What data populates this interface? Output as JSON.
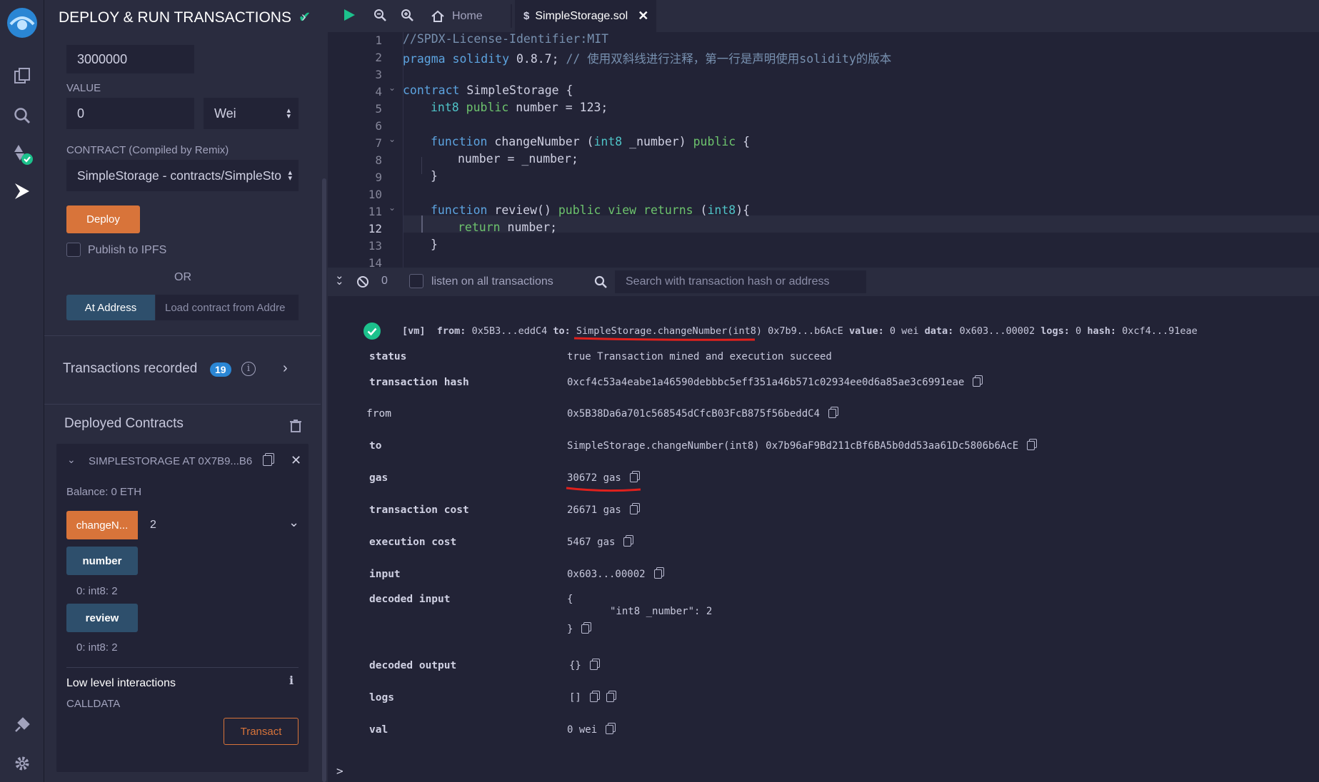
{
  "panel": {
    "title": "DEPLOY & RUN TRANSACTIONS",
    "gas_limit": "3000000",
    "value_label": "VALUE",
    "value": "0",
    "value_unit": "Wei",
    "contract_label": "CONTRACT",
    "contract_note": "(Compiled by Remix)",
    "contract_selected": "SimpleStorage - contracts/SimpleSto",
    "deploy_label": "Deploy",
    "publish_label": "Publish to IPFS",
    "or_label": "OR",
    "at_address_label": "At Address",
    "load_placeholder": "Load contract from Addre",
    "tx_recorded_label": "Transactions recorded",
    "tx_recorded_count": "19",
    "deployed_label": "Deployed Contracts",
    "instance_name": "SIMPLESTORAGE AT 0X7B9...B6",
    "balance": "Balance: 0 ETH",
    "change_btn": "changeN...",
    "change_input": "2",
    "number_btn": "number",
    "number_result": "0: int8: 2",
    "review_btn": "review",
    "review_result": "0: int8: 2",
    "low_level_label": "Low level interactions",
    "calldata_label": "CALLDATA",
    "transact_label": "Transact"
  },
  "tabs": {
    "home": "Home",
    "file": "SimpleStorage.sol"
  },
  "code_lines": [
    {
      "n": "1"
    },
    {
      "n": "2"
    },
    {
      "n": "3"
    },
    {
      "n": "4"
    },
    {
      "n": "5"
    },
    {
      "n": "6"
    },
    {
      "n": "7"
    },
    {
      "n": "8"
    },
    {
      "n": "9"
    },
    {
      "n": "10"
    },
    {
      "n": "11"
    },
    {
      "n": "12"
    },
    {
      "n": "13"
    },
    {
      "n": "14"
    }
  ],
  "code": {
    "l1": "//SPDX-License-Identifier:MIT",
    "l2a": "pragma solidity",
    "l2b": " 0.8.7; ",
    "l2c": "// 使用双斜线进行注释，第一行是声明使用solidity的版本",
    "l4a": "contract",
    "l4b": " SimpleStorage {",
    "l5a": "int8",
    "l5b": " public",
    "l5c": " number = 123;",
    "l7a": "function",
    "l7b": " changeNumber (",
    "l7c": "int8",
    "l7d": " _number) ",
    "l7e": "public",
    "l7f": " {",
    "l8": "number = _number;",
    "l9": "}",
    "l11a": "function",
    "l11b": " review() ",
    "l11c": "public view returns",
    "l11d": " (",
    "l11e": "int8",
    "l11f": "){",
    "l12a": "return",
    "l12b": " number;",
    "l13": "}"
  },
  "terminal": {
    "count": "0",
    "listen_label": "listen on all transactions",
    "search_placeholder": "Search with transaction hash or address",
    "summary_vm": "[vm]",
    "summary_from_k": "from:",
    "summary_from_v": "0x5B3...eddC4",
    "summary_to_k": "to:",
    "summary_to_v": "SimpleStorage.changeNumber(int8)",
    "summary_to_addr": "0x7b9...b6AcE",
    "summary_value_k": "value:",
    "summary_value_v": "0 wei",
    "summary_data_k": "data:",
    "summary_data_v": "0x603...00002",
    "summary_logs_k": "logs:",
    "summary_logs_v": "0",
    "summary_hash_k": "hash:",
    "summary_hash_v": "0xcf4...91eae",
    "rows": {
      "status_k": "status",
      "status_v": "true Transaction mined and execution succeed",
      "hash_k": "transaction hash",
      "hash_v": "0xcf4c53a4eabe1a46590debbbc5eff351a46b571c02934ee0d6a85ae3c6991eae",
      "from_k": "from",
      "from_v": "0x5B38Da6a701c568545dCfcB03FcB875f56beddC4",
      "to_k": "to",
      "to_v": "SimpleStorage.changeNumber(int8) 0x7b96aF9Bd211cBf6BA5b0dd53aa61Dc5806b6AcE",
      "gas_k": "gas",
      "gas_v": "30672 gas",
      "txcost_k": "transaction cost",
      "txcost_v": "26671 gas",
      "execcost_k": "execution cost",
      "execcost_v": "5467 gas",
      "input_k": "input",
      "input_v": "0x603...00002",
      "decin_k": "decoded input",
      "decin_open": "{",
      "decin_body": "\"int8 _number\": 2",
      "decin_close": "}",
      "decout_k": "decoded output",
      "decout_v": "{}",
      "logs_k": "logs",
      "logs_v": "[]",
      "val_k": "val",
      "val_v": "0 wei"
    },
    "prompt": ">"
  },
  "colors": {
    "accent_orange": "#d8743a",
    "button_blue": "#2e4f6c",
    "success_green": "#1cc18c",
    "annotation_red": "#e0211d"
  }
}
